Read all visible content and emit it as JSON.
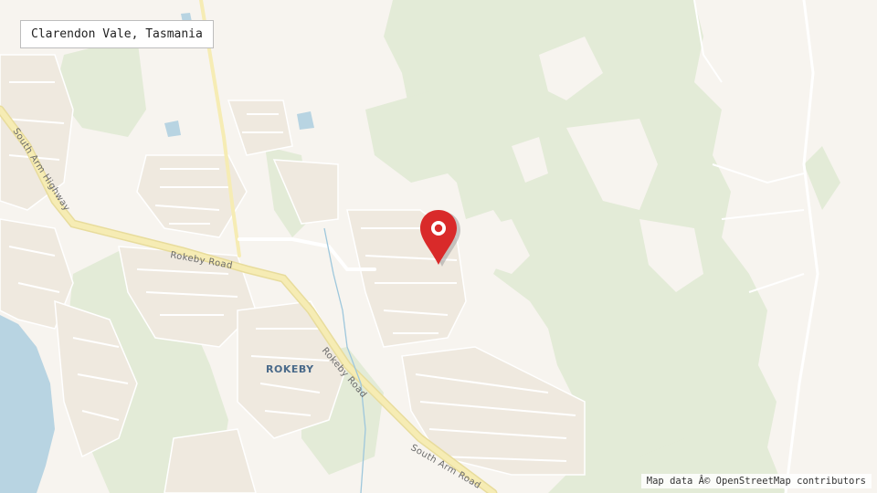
{
  "map_title": "Clarendon Vale, Tasmania",
  "attribution": "Map data Â© OpenStreetMap contributors",
  "labels": {
    "south_arm_highway": "South Arm Highway",
    "rokeby_road_west": "Rokeby Road",
    "rokeby_road_south": "Rokeby Road",
    "south_arm_road": "South Arm Road",
    "rokeby_suburb": "ROKEBY"
  },
  "marker": {
    "icon": "map-pin-icon",
    "color": "#d92a2a"
  },
  "colors": {
    "land": "#f7f4ef",
    "vegetation": "#e2ead5",
    "water": "#b8d4e2",
    "major_road": "#f3e7a6",
    "minor_road": "#ffffff",
    "residential": "#f1ece3"
  }
}
